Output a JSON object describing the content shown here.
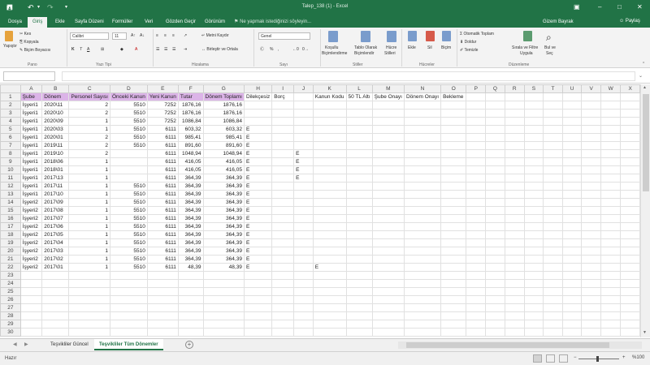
{
  "title": "Talep_138 (1) - Excel",
  "user": "Gizem Bayrak",
  "share": "Paylaş",
  "menu_tabs": [
    "Dosya",
    "Giriş",
    "Ekle",
    "Sayfa Düzeni",
    "Formüller",
    "Veri",
    "Gözden Geçir",
    "Görünüm"
  ],
  "tell_me": "Ne yapmak istediğinizi söyleyin...",
  "ribbon": {
    "paste": "Yapıştır",
    "cut": "Kes",
    "copy": "Kopyala",
    "format_painter": "Biçim Boyacısı",
    "font_name": "Calibri",
    "font_size": "11",
    "bold": "K",
    "italic": "T",
    "underline": "A",
    "wrap_text": "Metni Kaydır",
    "merge": "Birleştir ve Ortala",
    "number_format": "Genel",
    "cond_format_1": "Koşullu",
    "cond_format_2": "Biçimlendirme",
    "format_table_1": "Tablo Olarak",
    "format_table_2": "Biçimlendir",
    "cell_styles_1": "Hücre",
    "cell_styles_2": "Stilleri",
    "insert": "Ekle",
    "delete": "Sil",
    "format": "Biçim",
    "autosum": "Otomatik Toplam",
    "fill": "Doldur",
    "clear": "Temizle",
    "sort_1": "Sırala ve Filtre",
    "sort_2": "Uygula",
    "find_1": "Bul ve",
    "find_2": "Seç",
    "groups": [
      "Pano",
      "Yazı Tipi",
      "Hizalama",
      "Sayı",
      "Stiller",
      "Hücreler",
      "Düzenleme"
    ]
  },
  "columns": [
    "A",
    "B",
    "C",
    "D",
    "E",
    "F",
    "G",
    "H",
    "I",
    "J",
    "K",
    "L",
    "M",
    "N",
    "O",
    "P",
    "Q",
    "R",
    "S",
    "T",
    "U",
    "V",
    "W",
    "X"
  ],
  "rows": [
    [
      "Şube",
      "Dönem",
      "Personel Sayısı",
      "Önceki Kanun",
      "Yeni Kanun",
      "Tutar",
      "Dönem Toplamı",
      "Dilekçesiz",
      "Borç",
      "",
      "Kanun Kodu",
      "50 TL Altı",
      "Şube Onayı",
      "Dönem Onayı",
      "Bekleme",
      "",
      "",
      "",
      "",
      "",
      "",
      "",
      "",
      ""
    ],
    [
      "İşyeri1",
      "2020\\11",
      "2",
      "5510",
      "7252",
      "1876,16",
      "1876,16",
      "",
      "",
      "",
      "",
      "",
      "",
      "",
      "",
      "",
      "",
      "",
      "",
      "",
      "",
      "",
      "",
      ""
    ],
    [
      "İşyeri1",
      "2020\\10",
      "2",
      "5510",
      "7252",
      "1876,16",
      "1876,16",
      "",
      "",
      "",
      "",
      "",
      "",
      "",
      "",
      "",
      "",
      "",
      "",
      "",
      "",
      "",
      "",
      ""
    ],
    [
      "İşyeri1",
      "2020\\09",
      "1",
      "5510",
      "7252",
      "1086,84",
      "1086,84",
      "",
      "",
      "",
      "",
      "",
      "",
      "",
      "",
      "",
      "",
      "",
      "",
      "",
      "",
      "",
      "",
      ""
    ],
    [
      "İşyeri1",
      "2020\\03",
      "1",
      "5510",
      "6111",
      "603,32",
      "603,32",
      "E",
      "",
      "",
      "",
      "",
      "",
      "",
      "",
      "",
      "",
      "",
      "",
      "",
      "",
      "",
      "",
      ""
    ],
    [
      "İşyeri1",
      "2020\\01",
      "2",
      "5510",
      "6111",
      "985,41",
      "985,41",
      "E",
      "",
      "",
      "",
      "",
      "",
      "",
      "",
      "",
      "",
      "",
      "",
      "",
      "",
      "",
      "",
      ""
    ],
    [
      "İşyeri1",
      "2019\\11",
      "2",
      "5510",
      "6111",
      "891,60",
      "891,60",
      "E",
      "",
      "",
      "",
      "",
      "",
      "",
      "",
      "",
      "",
      "",
      "",
      "",
      "",
      "",
      "",
      ""
    ],
    [
      "İşyeri1",
      "2019\\10",
      "2",
      "",
      "6111",
      "1048,94",
      "1048,94",
      "E",
      "",
      "E",
      "",
      "",
      "",
      "",
      "",
      "",
      "",
      "",
      "",
      "",
      "",
      "",
      "",
      ""
    ],
    [
      "İşyeri1",
      "2018\\06",
      "1",
      "",
      "6111",
      "416,05",
      "416,05",
      "E",
      "",
      "E",
      "",
      "",
      "",
      "",
      "",
      "",
      "",
      "",
      "",
      "",
      "",
      "",
      "",
      ""
    ],
    [
      "İşyeri1",
      "2018\\01",
      "1",
      "",
      "6111",
      "416,05",
      "416,05",
      "E",
      "",
      "E",
      "",
      "",
      "",
      "",
      "",
      "",
      "",
      "",
      "",
      "",
      "",
      "",
      "",
      ""
    ],
    [
      "İşyeri1",
      "2017\\13",
      "1",
      "",
      "6111",
      "364,39",
      "364,39",
      "E",
      "",
      "E",
      "",
      "",
      "",
      "",
      "",
      "",
      "",
      "",
      "",
      "",
      "",
      "",
      "",
      ""
    ],
    [
      "İşyeri1",
      "2017\\11",
      "1",
      "5510",
      "6111",
      "364,39",
      "364,39",
      "E",
      "",
      "",
      "",
      "",
      "",
      "",
      "",
      "",
      "",
      "",
      "",
      "",
      "",
      "",
      "",
      ""
    ],
    [
      "İşyeri1",
      "2017\\10",
      "1",
      "5510",
      "6111",
      "364,39",
      "364,39",
      "E",
      "",
      "",
      "",
      "",
      "",
      "",
      "",
      "",
      "",
      "",
      "",
      "",
      "",
      "",
      "",
      ""
    ],
    [
      "İşyeri2",
      "2017\\09",
      "1",
      "5510",
      "6111",
      "364,39",
      "364,39",
      "E",
      "",
      "",
      "",
      "",
      "",
      "",
      "",
      "",
      "",
      "",
      "",
      "",
      "",
      "",
      "",
      ""
    ],
    [
      "İşyeri2",
      "2017\\08",
      "1",
      "5510",
      "6111",
      "364,39",
      "364,39",
      "E",
      "",
      "",
      "",
      "",
      "",
      "",
      "",
      "",
      "",
      "",
      "",
      "",
      "",
      "",
      "",
      ""
    ],
    [
      "İşyeri2",
      "2017\\07",
      "1",
      "5510",
      "6111",
      "364,39",
      "364,39",
      "E",
      "",
      "",
      "",
      "",
      "",
      "",
      "",
      "",
      "",
      "",
      "",
      "",
      "",
      "",
      "",
      ""
    ],
    [
      "İşyeri2",
      "2017\\06",
      "1",
      "5510",
      "6111",
      "364,39",
      "364,39",
      "E",
      "",
      "",
      "",
      "",
      "",
      "",
      "",
      "",
      "",
      "",
      "",
      "",
      "",
      "",
      "",
      ""
    ],
    [
      "İşyeri2",
      "2017\\05",
      "1",
      "5510",
      "6111",
      "364,39",
      "364,39",
      "E",
      "",
      "",
      "",
      "",
      "",
      "",
      "",
      "",
      "",
      "",
      "",
      "",
      "",
      "",
      "",
      ""
    ],
    [
      "İşyeri2",
      "2017\\04",
      "1",
      "5510",
      "6111",
      "364,39",
      "364,39",
      "E",
      "",
      "",
      "",
      "",
      "",
      "",
      "",
      "",
      "",
      "",
      "",
      "",
      "",
      "",
      "",
      ""
    ],
    [
      "İşyeri2",
      "2017\\03",
      "1",
      "5510",
      "6111",
      "364,39",
      "364,39",
      "E",
      "",
      "",
      "",
      "",
      "",
      "",
      "",
      "",
      "",
      "",
      "",
      "",
      "",
      "",
      "",
      ""
    ],
    [
      "İşyeri2",
      "2017\\02",
      "1",
      "5510",
      "6111",
      "364,39",
      "364,39",
      "E",
      "",
      "",
      "",
      "",
      "",
      "",
      "",
      "",
      "",
      "",
      "",
      "",
      "",
      "",
      "",
      ""
    ],
    [
      "İşyeri2",
      "2017\\01",
      "1",
      "5510",
      "6111",
      "48,39",
      "48,39",
      "E",
      "",
      "",
      "E",
      "",
      "",
      "",
      "",
      "",
      "",
      "",
      "",
      "",
      "",
      "",
      "",
      ""
    ],
    [
      "",
      "",
      "",
      "",
      "",
      "",
      "",
      "",
      "",
      "",
      "",
      "",
      "",
      "",
      "",
      "",
      "",
      "",
      "",
      "",
      "",
      "",
      "",
      ""
    ],
    [
      "",
      "",
      "",
      "",
      "",
      "",
      "",
      "",
      "",
      "",
      "",
      "",
      "",
      "",
      "",
      "",
      "",
      "",
      "",
      "",
      "",
      "",
      "",
      ""
    ],
    [
      "",
      "",
      "",
      "",
      "",
      "",
      "",
      "",
      "",
      "",
      "",
      "",
      "",
      "",
      "",
      "",
      "",
      "",
      "",
      "",
      "",
      "",
      "",
      ""
    ],
    [
      "",
      "",
      "",
      "",
      "",
      "",
      "",
      "",
      "",
      "",
      "",
      "",
      "",
      "",
      "",
      "",
      "",
      "",
      "",
      "",
      "",
      "",
      "",
      ""
    ],
    [
      "",
      "",
      "",
      "",
      "",
      "",
      "",
      "",
      "",
      "",
      "",
      "",
      "",
      "",
      "",
      "",
      "",
      "",
      "",
      "",
      "",
      "",
      "",
      ""
    ],
    [
      "",
      "",
      "",
      "",
      "",
      "",
      "",
      "",
      "",
      "",
      "",
      "",
      "",
      "",
      "",
      "",
      "",
      "",
      "",
      "",
      "",
      "",
      "",
      ""
    ],
    [
      "",
      "",
      "",
      "",
      "",
      "",
      "",
      "",
      "",
      "",
      "",
      "",
      "",
      "",
      "",
      "",
      "",
      "",
      "",
      "",
      "",
      "",
      "",
      ""
    ],
    [
      "",
      "",
      "",
      "",
      "",
      "",
      "",
      "",
      "",
      "",
      "",
      "",
      "",
      "",
      "",
      "",
      "",
      "",
      "",
      "",
      "",
      "",
      "",
      ""
    ]
  ],
  "sheets": [
    "Teşvikliler Güncel",
    "Teşvikliler Tüm Dönemler"
  ],
  "active_sheet": 1,
  "status": "Hazır",
  "zoom": "%100",
  "colors": {
    "accent": "#217346",
    "header_fill": "#dcb4e8"
  }
}
